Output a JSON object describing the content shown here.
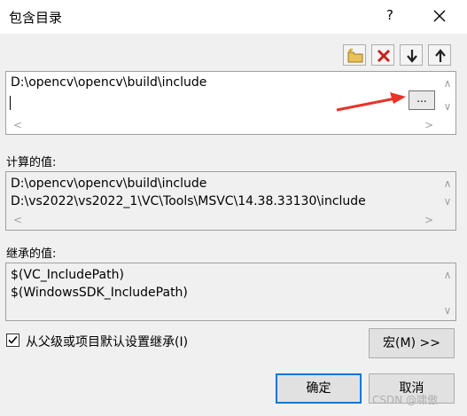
{
  "window": {
    "title": "包含目录",
    "help_label": "?"
  },
  "toolbar": {
    "new_line_icon": "new-folder-icon",
    "delete_icon": "delete-x-icon",
    "move_down_icon": "arrow-down-icon",
    "move_up_icon": "arrow-up-icon"
  },
  "edit": {
    "line1": "D:\\opencv\\opencv\\build\\include",
    "line2": "",
    "browse_label": "..."
  },
  "evaluated": {
    "label": "计算的值:",
    "lines": [
      "D:\\opencv\\opencv\\build\\include",
      "D:\\vs2022\\vs2022_1\\VC\\Tools\\MSVC\\14.38.33130\\include"
    ]
  },
  "inherited": {
    "label": "继承的值:",
    "lines": [
      "$(VC_IncludePath)",
      "$(WindowsSDK_IncludePath)"
    ]
  },
  "inherit_checkbox": {
    "label": "从父级或项目默认设置继承(I)",
    "checked": true
  },
  "buttons": {
    "macros": "宏(M) >>",
    "ok": "确定",
    "cancel": "取消"
  },
  "watermark": "CSDN @啸傲..."
}
